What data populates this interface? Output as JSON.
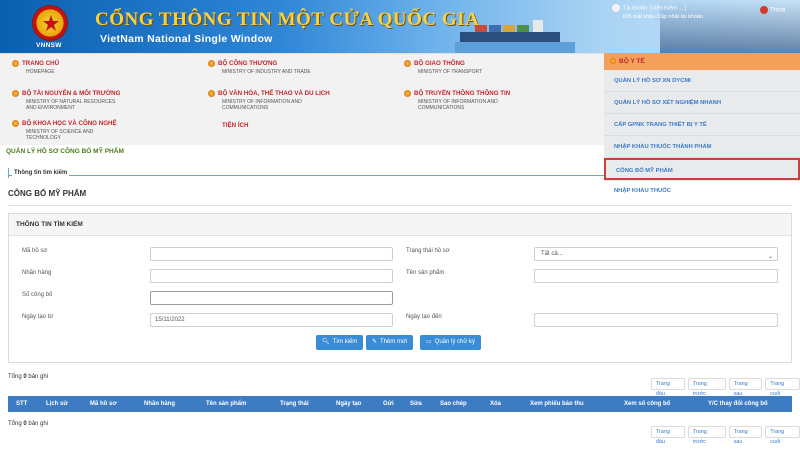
{
  "banner": {
    "emblem_text": "VNNSW",
    "title": "CỔNG THÔNG TIN MỘT CỬA QUỐC GIA",
    "subtitle": "VietNam National Single Window",
    "user_line1": "Tài khoản: [Viện Kiểm ... ]",
    "user_line2": "Đổi mật khẩu   Cập nhật tài khoản",
    "logout": "Thoát"
  },
  "ministries": [
    {
      "vn": "TRANG CHỦ",
      "en": "HOMEPAGE"
    },
    {
      "vn": "BỘ CÔNG THƯƠNG",
      "en": "MINISTRY OF INDUSTRY AND TRADE"
    },
    {
      "vn": "BỘ GIAO THÔNG",
      "en": "MINISTRY OF TRANSPORT"
    },
    {
      "vn": "BỘ TÀI NGUYÊN & MÔI TRƯỜNG",
      "en": "MINISTRY OF NATURAL RESOURCES AND ENVIRONMENT"
    },
    {
      "vn": "BỘ VĂN HÓA, THỂ THAO VÀ DU LỊCH",
      "en": "MINISTRY OF INFORMATION AND COMMUNICATIONS"
    },
    {
      "vn": "BỘ TRUYỀN THÔNG THÔNG TIN",
      "en": "MINISTRY OF INFORMATION AND COMMUNICATIONS"
    },
    {
      "vn": "BỘ KHOA HỌC VÀ CÔNG NGHỆ",
      "en": "MINISTRY OF SCIENCE AND TECHNOLOGY"
    },
    {
      "vn": "TIỆN ÍCH",
      "en": ""
    }
  ],
  "dropdown": {
    "head": "BỘ Y TẾ",
    "items": [
      "QUẢN LÝ HỒ SƠ XN DYCMI",
      "QUẢN LÝ HỒ SƠ XÉT NGHIỆM NHANH",
      "CẤP GPNK TRANG THIẾT BỊ Y TẾ",
      "NHẬP KHẨU THUỐC THÀNH PHẨM",
      "CÔNG BỐ MỸ PHẨM",
      "NHẬP KHẨU THUỐC"
    ]
  },
  "breadcrumb": "QUẢN LÝ HỒ SƠ CÔNG BỐ MỸ PHẨM",
  "legend": "Thông tin tìm kiếm",
  "page_title": "CÔNG BỐ MỸ PHẨM",
  "search": {
    "panel_title": "THÔNG TIN TÌM KIẾM",
    "labels": {
      "ma_ho_so": "Mã hồ sơ",
      "trang_thai": "Trạng thái hồ sơ",
      "nhan_hang": "Nhãn hàng",
      "ten_san_pham": "Tên sản phẩm",
      "so_cong_bo": "Số công bố",
      "ngay_tao_tu": "Ngày tạo từ",
      "ngay_tao_den": "Ngày tạo đến"
    },
    "values": {
      "trang_thai": "Tất cả...",
      "ngay_tao_tu": "15/11/2022"
    },
    "buttons": {
      "search": "Tìm kiếm",
      "add": "Thêm mới",
      "signature": "Quản lý chữ ký"
    }
  },
  "results": {
    "total_prefix": "Tổng",
    "total_count": "0",
    "total_suffix": "bản ghi"
  },
  "pager": [
    "Trang đầu",
    "Trang trước",
    "Trang sau",
    "Trang cuối"
  ],
  "table": {
    "columns": [
      "STT",
      "Lịch sử",
      "Mã hồ sơ",
      "Nhãn hàng",
      "Tên sản phẩm",
      "Trạng thái",
      "Ngày tạo",
      "Gửi",
      "Sửa",
      "Sao chép",
      "Xóa",
      "Xem phiếu báo thu",
      "Xem số công bố",
      "Y/C thay đổi công bố"
    ]
  },
  "colors": {
    "header_blue": "#3d7cc2",
    "button_blue": "#3a8cd6",
    "dropdown_head": "#f5a05a",
    "active_border": "#c9413f",
    "ministry_red": "#c1272d"
  }
}
